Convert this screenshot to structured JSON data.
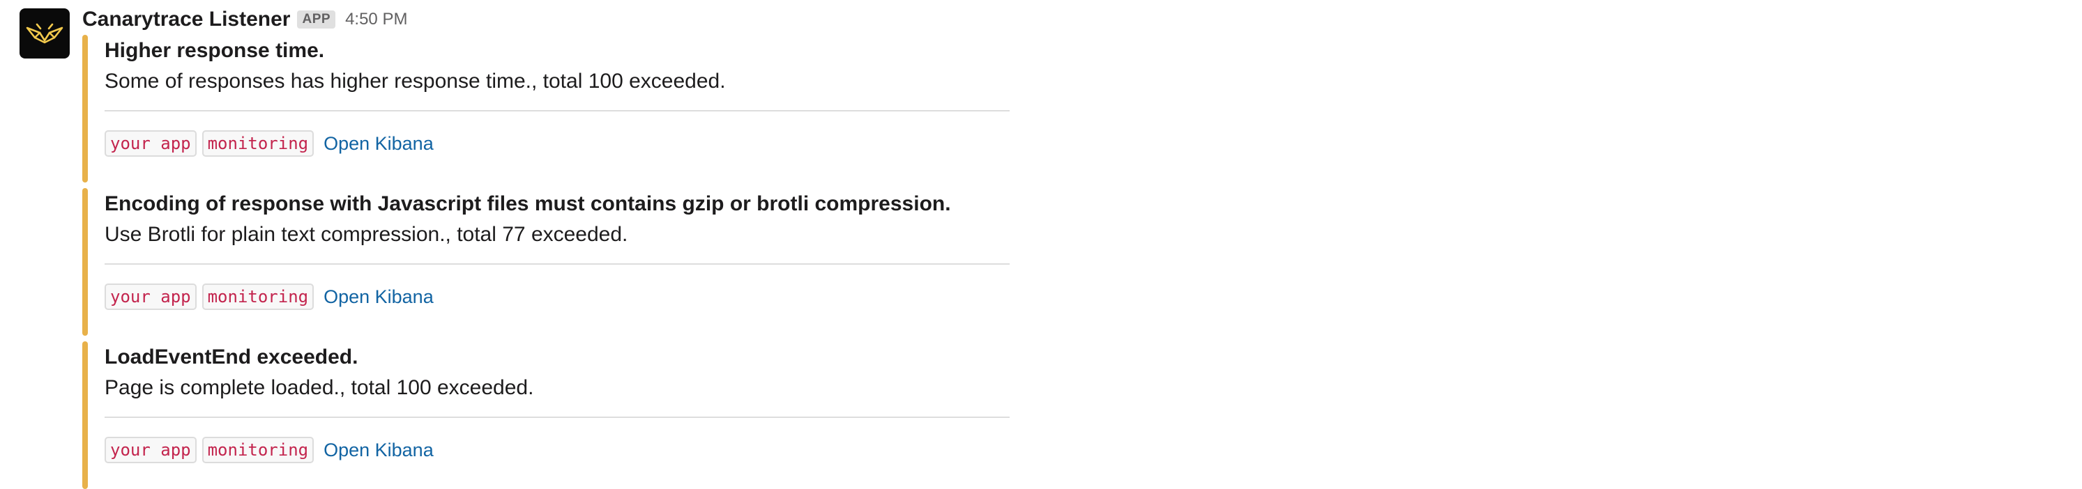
{
  "header": {
    "sender": "Canarytrace Listener",
    "badge": "APP",
    "time": "4:50 PM"
  },
  "colors": {
    "attachment_bar": "#e8b14a",
    "avatar_bg": "#0a0a0a",
    "logo": "#f2c94c",
    "link": "#1264a3",
    "tag_text": "#c3244d"
  },
  "attachments": [
    {
      "title": "Higher response time.",
      "text": "Some of responses has higher response time., total 100 exceeded.",
      "tags": [
        "your app",
        "monitoring"
      ],
      "link": "Open Kibana"
    },
    {
      "title": "Encoding of response with Javascript files must contains gzip or brotli compression.",
      "text": "Use Brotli for plain text compression., total 77 exceeded.",
      "tags": [
        "your app",
        "monitoring"
      ],
      "link": "Open Kibana"
    },
    {
      "title": "LoadEventEnd exceeded.",
      "text": "Page is complete loaded., total 100 exceeded.",
      "tags": [
        "your app",
        "monitoring"
      ],
      "link": "Open Kibana"
    }
  ]
}
